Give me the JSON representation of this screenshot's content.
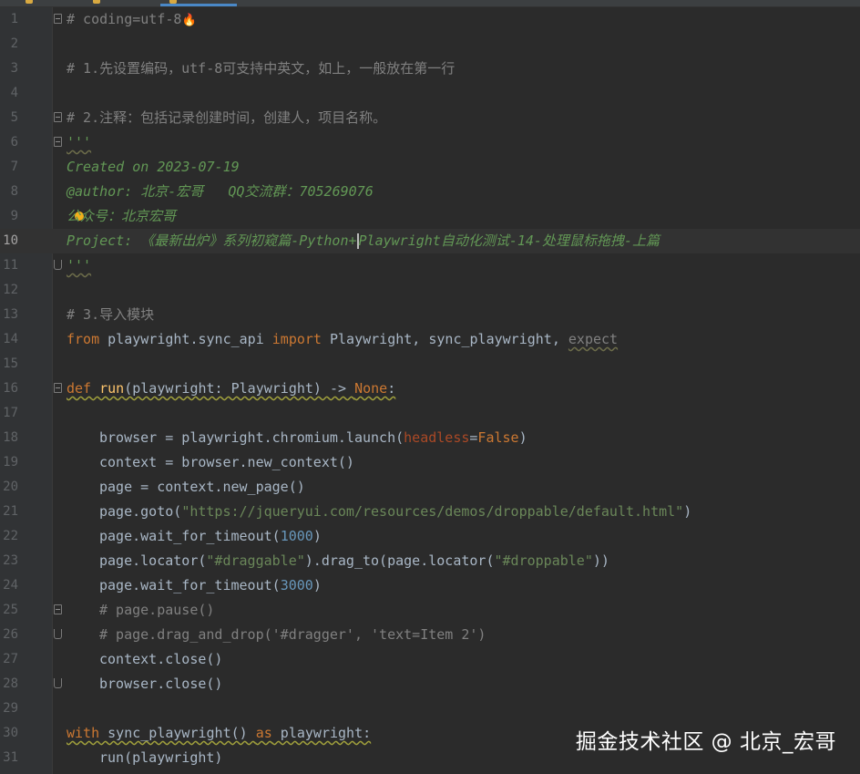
{
  "editor": {
    "current_line": 10,
    "lines": [
      {
        "n": "1",
        "text": "# coding=utf-8"
      },
      {
        "n": "2",
        "text": ""
      },
      {
        "n": "3",
        "text": "# 1.先设置编码，utf-8可支持中英文，如上，一般放在第一行"
      },
      {
        "n": "4",
        "text": ""
      },
      {
        "n": "5",
        "text": "# 2.注释：包括记录创建时间，创建人，项目名称。"
      },
      {
        "n": "6",
        "text": "'''"
      },
      {
        "n": "7",
        "text": "Created on 2023-07-19"
      },
      {
        "n": "8",
        "text": "@author: 北京-宏哥   QQ交流群：705269076"
      },
      {
        "n": "9",
        "text": "公众号：北京宏哥"
      },
      {
        "n": "10",
        "text_before": "Project: 《最新出炉》系列初窥篇-Python+",
        "text_after": "Playwright自动化测试-14-处理鼠标拖拽-上篇"
      },
      {
        "n": "11",
        "text": "'''"
      },
      {
        "n": "12",
        "text": ""
      },
      {
        "n": "13",
        "text": "# 3.导入模块"
      },
      {
        "n": "14",
        "from": "from",
        "mod": " playwright.sync_api ",
        "imp": "import",
        "names": " Playwright, sync_playwright, ",
        "expect": "expect"
      },
      {
        "n": "15",
        "text": ""
      },
      {
        "n": "16",
        "def": "def",
        "name": "run",
        "sig_open": "(playwright: Playwright) -> ",
        "none": "None",
        "colon": ":"
      },
      {
        "n": "17",
        "text": ""
      },
      {
        "n": "18",
        "pre": "browser = playwright.chromium.launch(",
        "kwarg": "headless",
        "eq": "=",
        "val": "False",
        "post": ")"
      },
      {
        "n": "19",
        "text": "context = browser.new_context()"
      },
      {
        "n": "20",
        "text": "page = context.new_page()"
      },
      {
        "n": "21",
        "pre": "page.goto(",
        "str": "\"https://jqueryui.com/resources/demos/droppable/default.html\"",
        "post": ")"
      },
      {
        "n": "22",
        "pre": "page.wait_for_timeout(",
        "num": "1000",
        "post": ")"
      },
      {
        "n": "23",
        "pre": "page.locator(",
        "str": "\"#draggable\"",
        "mid": ").drag_to(page.locator(",
        "str2": "\"#droppable\"",
        "post": "))"
      },
      {
        "n": "24",
        "pre": "page.wait_for_timeout(",
        "num": "3000",
        "post": ")"
      },
      {
        "n": "25",
        "text": "# page.pause()"
      },
      {
        "n": "26",
        "text": "# page.drag_and_drop('#dragger', 'text=Item 2')"
      },
      {
        "n": "27",
        "text": "context.close()"
      },
      {
        "n": "28",
        "text": "browser.close()"
      },
      {
        "n": "29",
        "text": ""
      },
      {
        "n": "30",
        "with": "with",
        "call": " sync_playwright() ",
        "as": "as",
        "target": " playwright:"
      },
      {
        "n": "31",
        "text": "run(playwright)"
      }
    ]
  },
  "watermark": "掘金技术社区 @ 北京_宏哥",
  "colors": {
    "background": "#2b2b2b",
    "gutter": "#313335",
    "keyword": "#cc7832",
    "string": "#6a8759",
    "number": "#6897bb",
    "comment": "#808080",
    "docstring": "#629755",
    "function": "#ffc66d"
  }
}
